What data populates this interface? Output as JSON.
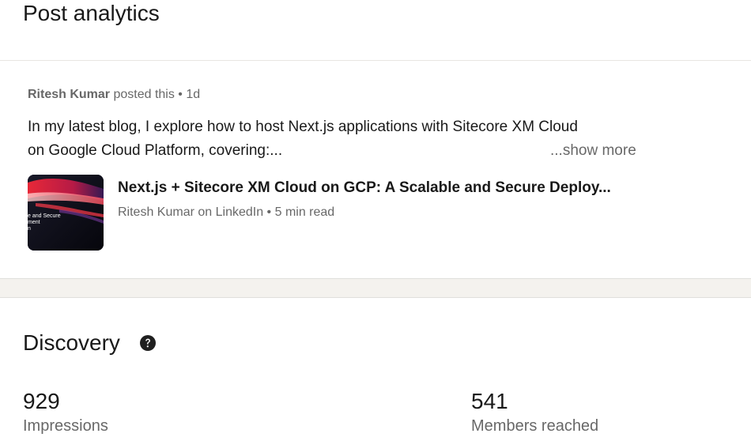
{
  "page": {
    "title": "Post analytics"
  },
  "post": {
    "author": "Ritesh Kumar",
    "posted_text": " posted this • 1d",
    "text_line1": "In my latest blog, I explore how to host Next.js applications with Sitecore XM Cloud",
    "text_line2": "on Google Cloud Platform, covering:...",
    "show_more": "...show more",
    "article": {
      "title": "Next.js + Sitecore XM Cloud on GCP: A Scalable and Secure Deploy...",
      "meta": "Ritesh Kumar on LinkedIn • 5 min read",
      "thumb_icon": "article-thumbnail-image",
      "thumb_text_line1": "e and Secure",
      "thumb_text_line2": "ment",
      "thumb_text_line3": "n"
    }
  },
  "discovery": {
    "title": "Discovery",
    "help_icon": "question-circle-icon",
    "metrics": [
      {
        "value": "929",
        "label": "Impressions"
      },
      {
        "value": "541",
        "label": "Members reached"
      }
    ]
  },
  "colors": {
    "background": "#f4f2ee",
    "card": "#ffffff",
    "text_primary": "#191919",
    "text_secondary": "#666666"
  }
}
